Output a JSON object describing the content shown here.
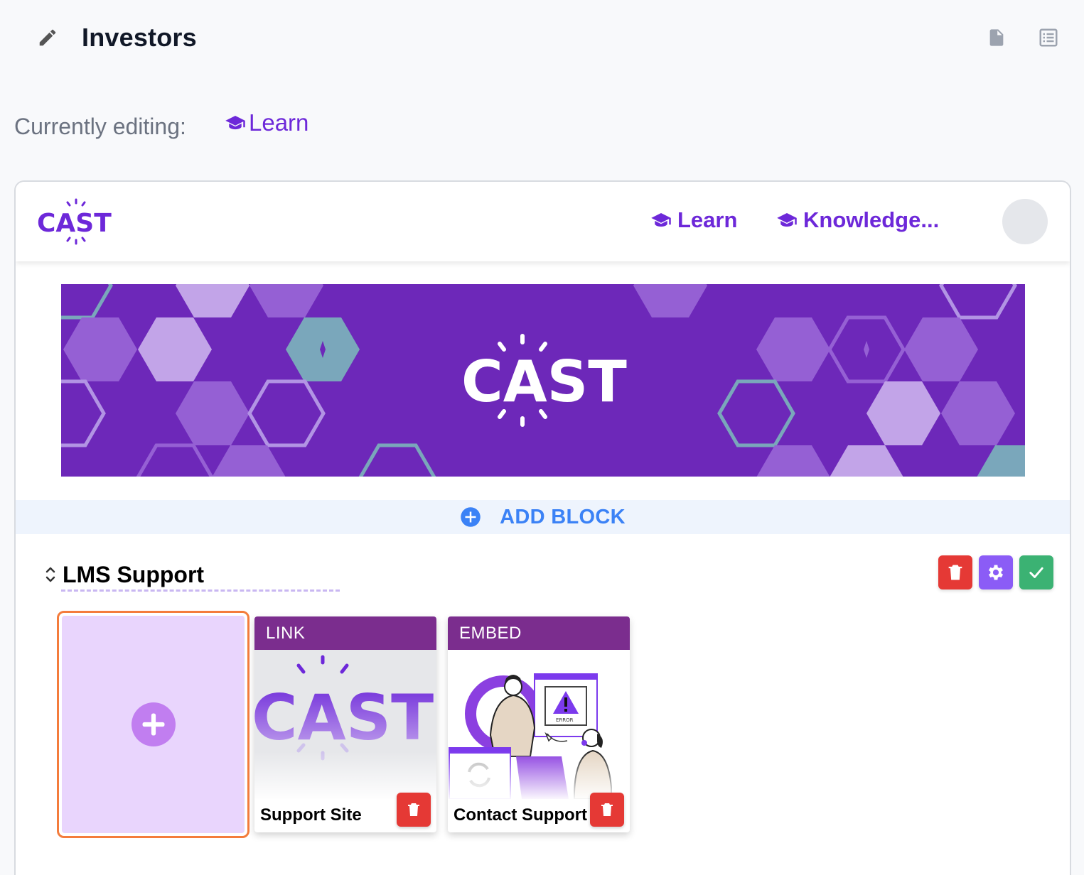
{
  "header": {
    "title": "Investors",
    "edit_icon": "pencil-icon",
    "actions": [
      "document-icon",
      "list-view-icon"
    ]
  },
  "editing": {
    "label": "Currently editing:",
    "page": "Learn",
    "page_icon": "graduation-cap-icon"
  },
  "site": {
    "logo_text": "CAST",
    "nav": [
      {
        "label": "Learn",
        "icon": "graduation-cap-icon"
      },
      {
        "label": "Knowledge...",
        "icon": "graduation-cap-icon"
      }
    ],
    "banner_logo_text": "CAST"
  },
  "add_block": {
    "label": "ADD BLOCK",
    "icon": "plus-circle-icon"
  },
  "section": {
    "title": "LMS Support",
    "actions": [
      "trash-icon",
      "gear-icon",
      "check-icon"
    ],
    "cards": [
      {
        "type": "LINK",
        "label": "Support Site",
        "image_text": "CAST"
      },
      {
        "type": "EMBED",
        "label": "Contact Support",
        "image_text": "ERROR"
      }
    ]
  },
  "colors": {
    "brand_purple": "#6d28d9",
    "banner_bg": "#6d28b9",
    "card_header": "#7b2d8e",
    "add_block_blue": "#3b82f6",
    "danger": "#e53935",
    "settings": "#8b5cf6",
    "success": "#3bb273",
    "selected_border": "#f47c3c"
  }
}
